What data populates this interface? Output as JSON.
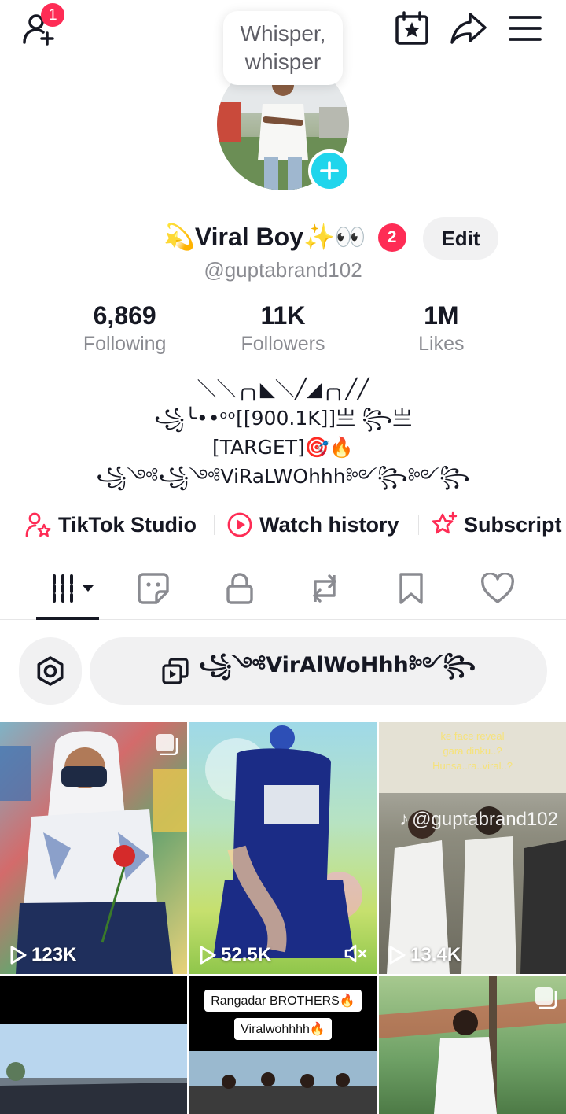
{
  "header": {
    "friend_request_count": "1",
    "whisper_bubble": [
      "Whisper,",
      "whisper"
    ]
  },
  "profile": {
    "display_name": "💫Viral Boy✨👀",
    "name_badge": "2",
    "edit_label": "Edit",
    "handle": "@guptabrand102",
    "stats": [
      {
        "value": "6,869",
        "label": "Following"
      },
      {
        "value": "11K",
        "label": "Followers"
      },
      {
        "value": "1M",
        "label": "Likes"
      }
    ],
    "bio_lines": [
      "＼＼╭╮◣＼╱◢╭╮╱╱",
      "꧁╰••ᵒᵒ[[900.1K]]亗 ꧂亗",
      "[TARGET]🎯🔥",
      "꧁༺꧁༺ViRaLWOhhh༻꧂༻꧂"
    ]
  },
  "shortcuts": [
    {
      "label": "TikTok Studio"
    },
    {
      "label": "Watch history"
    },
    {
      "label": "Subscript"
    }
  ],
  "filter": {
    "playlist_label": "꧁༺VirAlWoHhh༻꧂"
  },
  "videos": [
    {
      "views": "123K"
    },
    {
      "views": "52.5K"
    },
    {
      "views": "13.4K",
      "overlay_text": [
        "ke face reveal",
        "gara dinku..?",
        "Hunsa..ra..viral..?"
      ],
      "watermark": "@guptabrand102"
    },
    {
      "views": ""
    },
    {
      "views": "",
      "overlay_text": [
        "Rangadar BROTHERS🔥",
        "Viralwohhhh🔥"
      ]
    },
    {
      "views": ""
    }
  ],
  "colors": {
    "accent_red": "#fe2c55",
    "accent_cyan": "#20d5ec",
    "text_primary": "#161823",
    "text_secondary": "#8a8b91"
  }
}
